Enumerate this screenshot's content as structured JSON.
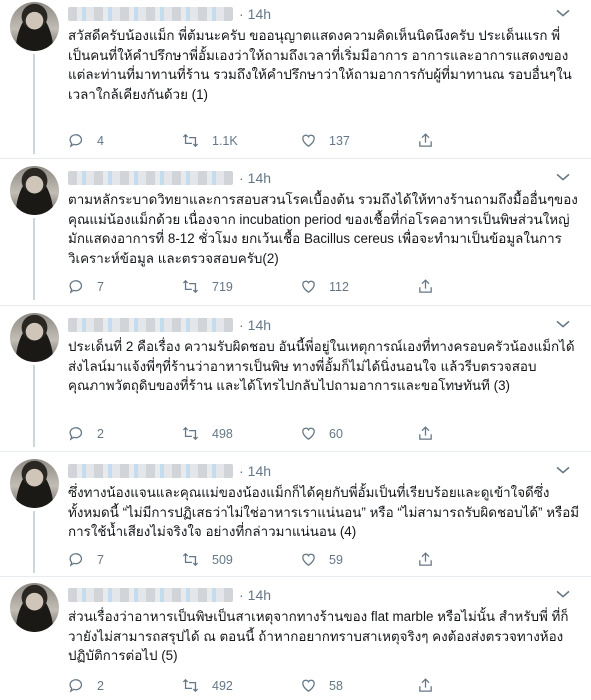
{
  "tweets": [
    {
      "time": "14h",
      "text": "สวัสดีครับน้องแม็ก พี่ต้มนะครับ ขออนุญาตแสดงความคิดเห็นนิดนึงครับ ประเด็นแรก พี่เป็นคนที่ให้คำปรึกษาพี่อั้มเองว่าให้ถามถึงเวลาที่เริ่มมีอาการ อาการและอาการแสดงของแต่ละท่านที่มาทานที่ร้าน รวมถึงให้คำปรึกษาว่าให้ถามอาการกับผู้ที่มาทานณ รอบอื่นๆในเวลาใกล้เคียงกันด้วย (1)",
      "replies": "4",
      "retweets": "1.1K",
      "likes": "137"
    },
    {
      "time": "14h",
      "text": "ตามหลักระบาดวิทยาและการสอบสวนโรคเบื้องต้น รวมถึงได้ให้ทางร้านถามถึงมื้ออื่นๆของคุณแม่น้องแม็กด้วย เนื่องจาก incubation period ของเชื้อที่ก่อโรคอาหารเป็นพิษส่วนใหญ่ มักแสดงอาการที่ 8-12 ชั่วโมง ยกเว้นเชื้อ Bacillus cereus เพื่อจะทำมาเป็นข้อมูลในการวิเคราะห์ข้อมูล และตรวจสอบครับ(2)",
      "replies": "7",
      "retweets": "719",
      "likes": "112"
    },
    {
      "time": "14h",
      "text": "ประเด็นที่ 2 คือเรื่อง ความรับผิดชอบ อันนี้พี่อยู่ในเหตุการณ์เองที่ทางครอบครัวน้องแม็กได้ส่งไลน์มาแจ้งพี่ๆที่ร้านว่าอาหารเป็นพิษ ทางพี่อั้มก็ไม่ได้นิ่งนอนใจ แล้วรีบตรวจสอบคุณภาพวัตถุดิบของที่ร้าน และได้โทรไปกลับไปถามอาการและขอโทษทันที (3)",
      "replies": "2",
      "retweets": "498",
      "likes": "60"
    },
    {
      "time": "14h",
      "text": "ซึ่งทางน้องแจนและคุณแม่ของน้องแม็กก็ได้คุยกับพี่อั้มเป็นที่เรียบร้อยและดูเข้าใจดีซึ่งทั้งหมดนี้ “ไม่มีการปฏิเสธว่าไม่ใช่อาหารเราแน่นอน” หรือ “ไม่สามารถรับผิดชอบได้” หรือมีการใช้น้ำเสียงไม่จริงใจ อย่างที่กล่าวมาแน่นอน (4)",
      "replies": "7",
      "retweets": "509",
      "likes": "59"
    },
    {
      "time": "14h",
      "text": "ส่วนเรื่องว่าอาหารเป็นพิษเป็นสาเหตุจากทางร้านของ flat marble หรือไม่นั้น สำหรับพี่ ที่ก็วายังไม่สามารถสรุปได้ ณ ตอนนี้ ถ้าหากอยากทราบสาเหตุจริงๆ คงต้องส่งตรวจทางห้องปฏิบัติการต่อไป (5)",
      "replies": "2",
      "retweets": "492",
      "likes": "58"
    }
  ],
  "colors": {
    "muted": "#657786",
    "text": "#14171a",
    "thread_line": "#ccd6dd",
    "separator": "#e6ecf0"
  },
  "icons": [
    "reply-icon",
    "retweet-icon",
    "like-icon",
    "share-icon",
    "caret-down-icon"
  ]
}
